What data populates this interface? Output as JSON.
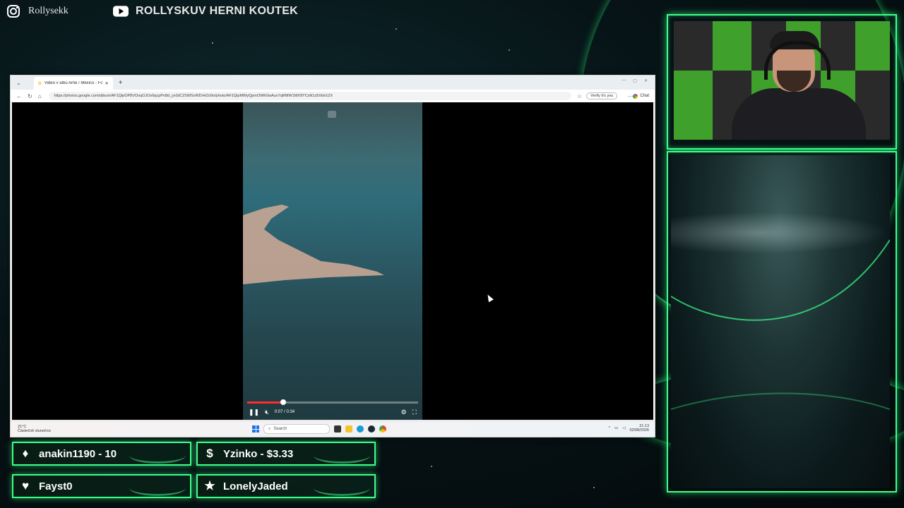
{
  "overlay": {
    "instagram_handle": "Rollysekk",
    "youtube_channel": "ROLLYSKUV HERNI KOUTEK"
  },
  "browser": {
    "tab_title": "Video v albu Ame / Mexico - Foto",
    "url": "https://photos.google.com/album/AF1QipOP8VOoqOJOx6qcpPn8d_yxGlC2SWSvWDrHZn9o/photo/AF1QipMWyQpmOWK0wAun7qRMW1MX8YCsN1z5XkkXZX",
    "verify_label": "Verify it's you",
    "chat_label": "Chat"
  },
  "video": {
    "time_current": "0:07",
    "time_total": "0:34",
    "time_display": "0:07 / 0:34",
    "progress": 0.21
  },
  "taskbar": {
    "weather_temp": "21°C",
    "weather_desc": "Částečně slunečno",
    "search_placeholder": "Search",
    "time": "21:13",
    "date": "02/08/2026"
  },
  "events": [
    {
      "icon": "diamond-icon",
      "label": "anakin1190 - 10"
    },
    {
      "icon": "dollar-icon",
      "label": "Yzinko - $3.33"
    },
    {
      "icon": "heart-icon",
      "label": "Fayst0"
    },
    {
      "icon": "star-icon",
      "label": "LonelyJaded"
    }
  ],
  "colors": {
    "accent_green": "#3dff8a",
    "progress_red": "#ff2d2d"
  }
}
